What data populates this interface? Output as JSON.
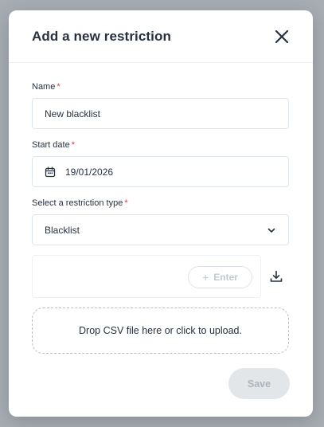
{
  "modal": {
    "title": "Add a new restriction",
    "close_icon": "close-icon"
  },
  "form": {
    "name": {
      "label": "Name",
      "required_mark": "*",
      "value": "New blacklist"
    },
    "start_date": {
      "label": "Start date",
      "required_mark": "*",
      "value": "19/01/2026",
      "icon": "calendar-icon"
    },
    "restriction_type": {
      "label": "Select a restriction type",
      "required_mark": "*",
      "selected": "Blacklist",
      "icon": "chevron-down-icon"
    },
    "enter_button": {
      "icon": "plus-icon",
      "label": "Enter"
    },
    "download_icon": "download-icon",
    "dropzone_text": "Drop CSV file here or click to upload."
  },
  "footer": {
    "save_label": "Save"
  },
  "colors": {
    "title": "#263140",
    "required": "#d63a3a",
    "disabled_bg": "#e3e6e9",
    "disabled_text": "#aeb4ba"
  }
}
